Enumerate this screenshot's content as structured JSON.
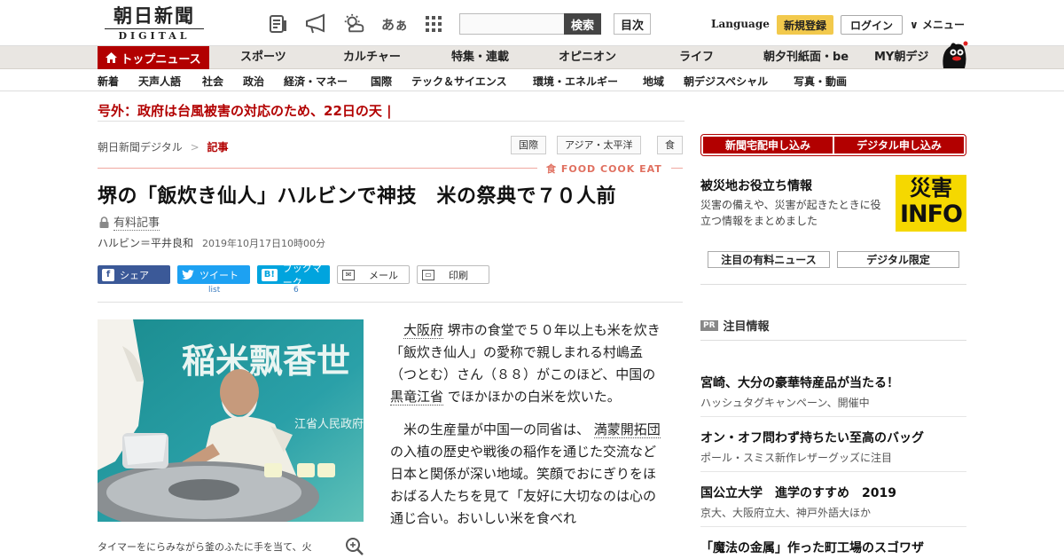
{
  "header": {
    "logo_line1": "朝日新聞",
    "logo_line2": "DIGITAL",
    "search_placeholder": "",
    "search_button": "検索",
    "toc_button": "目次",
    "language": "Language",
    "register": "新規登録",
    "login": "ログイン",
    "menu": "メニュー",
    "kana_icon": "あぁ"
  },
  "nav": {
    "home": "トップニュース",
    "items": [
      "スポーツ",
      "カルチャー",
      "特集・連載",
      "オピニオン",
      "ライフ",
      "朝夕刊紙面・be",
      "MY朝デジ"
    ]
  },
  "subnav": {
    "items": [
      "新着",
      "天声人語",
      "社会",
      "政治",
      "経済・マネー",
      "国際",
      "テック＆サイエンス",
      "環境・エネルギー",
      "地域",
      "朝デジスペシャル",
      "写真・動画"
    ]
  },
  "breaking": "号外：政府は台風被害の対応のため、22日の天 |",
  "breadcrumb": {
    "root": "朝日新聞デジタル",
    "sep": ">",
    "current": "記事"
  },
  "tags": [
    "国際",
    "アジア・太平洋",
    "食"
  ],
  "food_label": "食 FOOD COOK EAT",
  "article": {
    "headline": "堺の「飯炊き仙人」ハルビンで神技　米の祭典で７０人前",
    "paid_label": "有料記事",
    "author": "ハルビン＝平井良和",
    "date": "2019年10月17日10時00分",
    "caption": "タイマーをにらみながら釜のふたに手を当て、火",
    "photo_text": "稲米飘香世",
    "photo_sub": "江省人民政府",
    "p1": {
      "link1": "大阪府",
      "t1": " 堺市の食堂で５０年以上も米を炊き「飯炊き仙人」の愛称で親しまれる村嶋孟（つとむ）さん（８８）がこのほど、中国の ",
      "link2": "黒竜江省",
      "t2": " でほかほかの白米を炊いた。"
    },
    "p2": {
      "t1": "米の生産量が中国一の同省は、 ",
      "link1": "満蒙開拓団",
      "t2": " の入植の歴史や戦後の稲作を通じた交流など日本と関係が深い地域。笑顔でおにぎりをほおばる人たちを見て「友好に大切なのは心の通じ合い。おいしい米を食べれ"
    }
  },
  "share": {
    "facebook": "シェア",
    "twitter": "ツイート",
    "hatena": "ブックマーク",
    "hatena_icon": "B!",
    "mail": "メール",
    "print": "印刷",
    "twitter_count": "list",
    "hatena_count": "6"
  },
  "sidebar": {
    "delivery": "新聞宅配申し込み",
    "digital": "デジタル申し込み",
    "disaster_title": "被災地お役立ち情報",
    "disaster_desc": "災害の備えや、災害が起きたときに役立つ情報をまとめました",
    "badge_line1": "災害",
    "badge_line2": "INFO",
    "btn_paid_news": "注目の有料ニュース",
    "btn_digital_limited": "デジタル限定",
    "pr_icon": "PR",
    "pr_heading": "注目情報",
    "pr_items": [
      {
        "title": "宮崎、大分の豪華特産品が当たる！",
        "sub": "ハッシュタグキャンペーン、開催中"
      },
      {
        "title": "オン・オフ問わず持ちたい至高のバッグ",
        "sub": "ポール・スミス新作レザーグッズに注目"
      },
      {
        "title": "国公立大学　進学のすすめ　2019",
        "sub": "京大、大阪府立大、神戸外語大ほか"
      },
      {
        "title": "「魔法の金属」作った町工場のスゴワザ",
        "sub": ""
      }
    ]
  },
  "colors": {
    "brand_red": "#b20000",
    "register_yellow": "#f2c94c",
    "facebook": "#3b5998",
    "twitter": "#1da1f2",
    "hatena": "#00a4de",
    "badge_yellow": "#f5d800"
  },
  "icons": [
    "news-paper-icon",
    "megaphone-icon",
    "weather-icon",
    "kana-size-icon",
    "grid-menu-icon",
    "home-icon",
    "lock-icon",
    "zoom-in-icon",
    "mail-icon",
    "print-icon",
    "chevron-down-icon",
    "mascot-icon"
  ]
}
